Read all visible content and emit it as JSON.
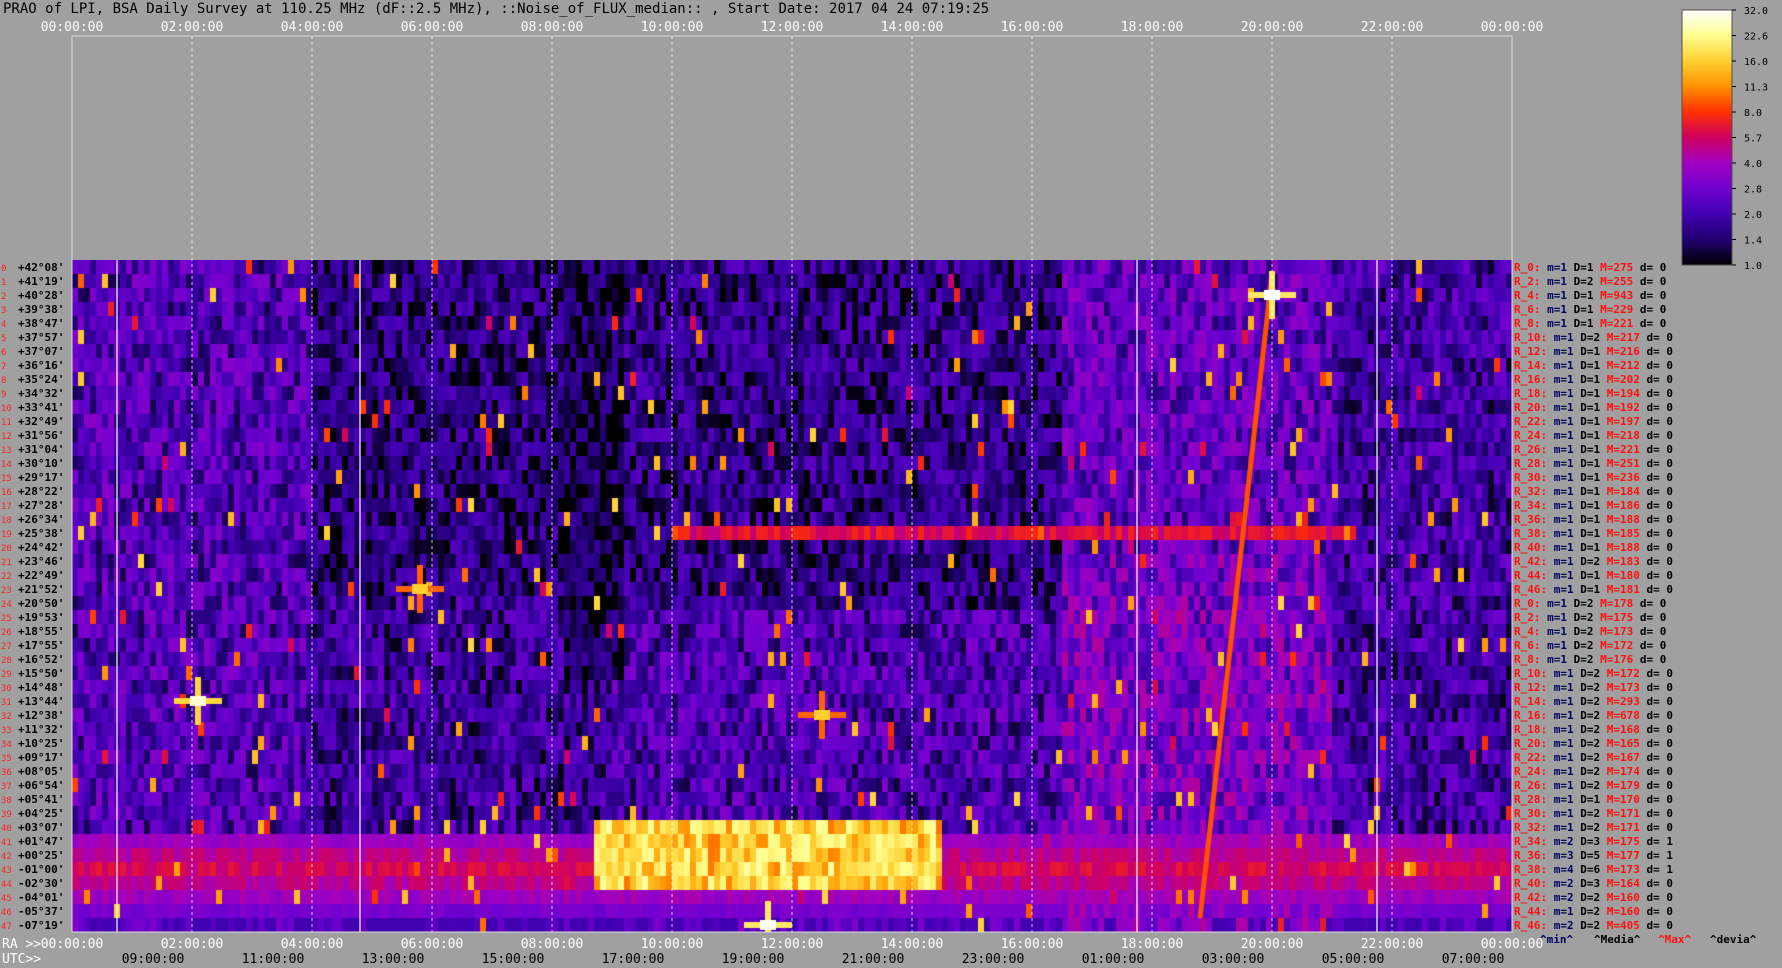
{
  "window": {
    "title": "PRAO of LPI, BSA Daily Survey at 110.25 MHz (dF::2.5 MHz), ::Noise_of_FLUX_median:: , Start Date: 2017 04 24 07:19:25"
  },
  "chart_data": {
    "type": "heatmap",
    "title": "PRAO of LPI, BSA Daily Survey at 110.25 MHz (dF::2.5 MHz), ::Noise_of_FLUX_median:: , Start Date: 2017 04 24 07:19:25",
    "x_top_ticks": [
      "00:00:00",
      "02:00:00",
      "04:00:00",
      "06:00:00",
      "08:00:00",
      "10:00:00",
      "12:00:00",
      "14:00:00",
      "16:00:00",
      "18:00:00",
      "20:00:00",
      "22:00:00",
      "00:00:00"
    ],
    "x_bottom_ra_label": "RA >>",
    "x_bottom_ra_ticks": [
      "00:00:00",
      "02:00:00",
      "04:00:00",
      "06:00:00",
      "08:00:00",
      "10:00:00",
      "12:00:00",
      "14:00:00",
      "16:00:00",
      "18:00:00",
      "20:00:00",
      "22:00:00",
      "00:00:00"
    ],
    "x_bottom_utc_label": "UTC>>",
    "x_bottom_utc_ticks": [
      "09:00:00",
      "11:00:00",
      "13:00:00",
      "15:00:00",
      "17:00:00",
      "19:00:00",
      "21:00:00",
      "23:00:00",
      "01:00:00",
      "03:00:00",
      "05:00:00",
      "07:00:00"
    ],
    "y_row_numbers": [
      "0",
      "1",
      "2",
      "3",
      "4",
      "5",
      "6",
      "7",
      "8",
      "9",
      "10",
      "11",
      "12",
      "13",
      "14",
      "15",
      "16",
      "17",
      "18",
      "19",
      "20",
      "21",
      "22",
      "23",
      "24",
      "25",
      "26",
      "27",
      "28",
      "29",
      "30",
      "31",
      "32",
      "33",
      "34",
      "35",
      "36",
      "37",
      "38",
      "39",
      "40",
      "41",
      "42",
      "43",
      "44",
      "45",
      "46",
      "47",
      "0",
      "1",
      "2",
      "3",
      "4",
      "5",
      "6",
      "7",
      "8",
      "9",
      "10",
      "11",
      "12",
      "13",
      "14",
      "15",
      "16",
      "17",
      "18",
      "19",
      "20",
      "21",
      "22",
      "23",
      "24",
      "25",
      "26",
      "27",
      "28",
      "29",
      "30",
      "31",
      "32",
      "33",
      "34",
      "35",
      "36",
      "37",
      "38",
      "39",
      "40",
      "41",
      "42",
      "43",
      "44",
      "45",
      "46",
      "47"
    ],
    "y_declination_labels": [
      "+42°08'",
      "+41°19'",
      "+40°28'",
      "+39°38'",
      "+38°47'",
      "+37°57'",
      "+37°07'",
      "+36°16'",
      "+35°24'",
      "+34°32'",
      "+33°41'",
      "+32°49'",
      "+31°56'",
      "+31°04'",
      "+30°10'",
      "+29°17'",
      "+28°22'",
      "+27°28'",
      "+26°34'",
      "+25°38'",
      "+24°42'",
      "+23°46'",
      "+22°49'",
      "+21°52'",
      "+20°50'",
      "+19°53'",
      "+18°55'",
      "+17°55'",
      "+16°52'",
      "+15°50'",
      "+14°48'",
      "+13°44'",
      "+12°38'",
      "+11°32'",
      "+10°25'",
      "+09°17'",
      "+08°05'",
      "+06°54'",
      "+05°41'",
      "+04°25'",
      "+03°07'",
      "+01°47'",
      "+00°25'",
      "-01°00'",
      "-02°30'",
      "-04°01'",
      "-05°37'",
      "-07°19'"
    ],
    "colorbar": {
      "ticks": [
        "32.0",
        "22.6",
        "16.0",
        "11.3",
        "8.0",
        "5.7",
        "4.0",
        "2.8",
        "2.0",
        "1.4",
        "1.0"
      ],
      "colors": [
        "#ffffff",
        "#ffff90",
        "#ffd030",
        "#ff9000",
        "#ff3000",
        "#d00060",
        "#a000c0",
        "#7000d0",
        "#4000b0",
        "#200070",
        "#000000"
      ]
    },
    "right_panel": {
      "headers": [
        "^min^",
        "^Media^",
        "^Max^",
        "^devia^"
      ],
      "rows": [
        [
          "R_0:",
          "m=1",
          "D=1",
          "M=275",
          "d= 0"
        ],
        [
          "R_2:",
          "m=1",
          "D=2",
          "M=255",
          "d= 0"
        ],
        [
          "R_4:",
          "m=1",
          "D=1",
          "M=943",
          "d= 0"
        ],
        [
          "R_6:",
          "m=1",
          "D=1",
          "M=229",
          "d= 0"
        ],
        [
          "R_8:",
          "m=1",
          "D=1",
          "M=221",
          "d= 0"
        ],
        [
          "R_10:",
          "m=1",
          "D=2",
          "M=217",
          "d= 0"
        ],
        [
          "R_12:",
          "m=1",
          "D=1",
          "M=216",
          "d= 0"
        ],
        [
          "R_14:",
          "m=1",
          "D=1",
          "M=212",
          "d= 0"
        ],
        [
          "R_16:",
          "m=1",
          "D=1",
          "M=202",
          "d= 0"
        ],
        [
          "R_18:",
          "m=1",
          "D=1",
          "M=194",
          "d= 0"
        ],
        [
          "R_20:",
          "m=1",
          "D=1",
          "M=192",
          "d= 0"
        ],
        [
          "R_22:",
          "m=1",
          "D=1",
          "M=197",
          "d= 0"
        ],
        [
          "R_24:",
          "m=1",
          "D=1",
          "M=218",
          "d= 0"
        ],
        [
          "R_26:",
          "m=1",
          "D=1",
          "M=221",
          "d= 0"
        ],
        [
          "R_28:",
          "m=1",
          "D=1",
          "M=251",
          "d= 0"
        ],
        [
          "R_30:",
          "m=1",
          "D=1",
          "M=236",
          "d= 0"
        ],
        [
          "R_32:",
          "m=1",
          "D=1",
          "M=184",
          "d= 0"
        ],
        [
          "R_34:",
          "m=1",
          "D=1",
          "M=186",
          "d= 0"
        ],
        [
          "R_36:",
          "m=1",
          "D=1",
          "M=188",
          "d= 0"
        ],
        [
          "R_38:",
          "m=1",
          "D=1",
          "M=185",
          "d= 0"
        ],
        [
          "R_40:",
          "m=1",
          "D=1",
          "M=188",
          "d= 0"
        ],
        [
          "R_42:",
          "m=1",
          "D=2",
          "M=183",
          "d= 0"
        ],
        [
          "R_44:",
          "m=1",
          "D=1",
          "M=180",
          "d= 0"
        ],
        [
          "R_46:",
          "m=1",
          "D=1",
          "M=181",
          "d= 0"
        ],
        [
          "R_0:",
          "m=1",
          "D=2",
          "M=178",
          "d= 0"
        ],
        [
          "R_2:",
          "m=1",
          "D=2",
          "M=175",
          "d= 0"
        ],
        [
          "R_4:",
          "m=1",
          "D=2",
          "M=173",
          "d= 0"
        ],
        [
          "R_6:",
          "m=1",
          "D=2",
          "M=172",
          "d= 0"
        ],
        [
          "R_8:",
          "m=1",
          "D=2",
          "M=176",
          "d= 0"
        ],
        [
          "R_10:",
          "m=1",
          "D=2",
          "M=172",
          "d= 0"
        ],
        [
          "R_12:",
          "m=1",
          "D=2",
          "M=173",
          "d= 0"
        ],
        [
          "R_14:",
          "m=1",
          "D=2",
          "M=293",
          "d= 0"
        ],
        [
          "R_16:",
          "m=1",
          "D=2",
          "M=678",
          "d= 0"
        ],
        [
          "R_18:",
          "m=1",
          "D=2",
          "M=168",
          "d= 0"
        ],
        [
          "R_20:",
          "m=1",
          "D=2",
          "M=165",
          "d= 0"
        ],
        [
          "R_22:",
          "m=1",
          "D=2",
          "M=167",
          "d= 0"
        ],
        [
          "R_24:",
          "m=1",
          "D=2",
          "M=174",
          "d= 0"
        ],
        [
          "R_26:",
          "m=1",
          "D=2",
          "M=179",
          "d= 0"
        ],
        [
          "R_28:",
          "m=1",
          "D=1",
          "M=170",
          "d= 0"
        ],
        [
          "R_30:",
          "m=1",
          "D=2",
          "M=171",
          "d= 0"
        ],
        [
          "R_32:",
          "m=1",
          "D=2",
          "M=171",
          "d= 0"
        ],
        [
          "R_34:",
          "m=2",
          "D=3",
          "M=175",
          "d= 1"
        ],
        [
          "R_36:",
          "m=3",
          "D=5",
          "M=177",
          "d= 1"
        ],
        [
          "R_38:",
          "m=4",
          "D=6",
          "M=173",
          "d= 1"
        ],
        [
          "R_40:",
          "m=2",
          "D=3",
          "M=164",
          "d= 0"
        ],
        [
          "R_42:",
          "m=2",
          "D=2",
          "M=160",
          "d= 0"
        ],
        [
          "R_44:",
          "m=1",
          "D=2",
          "M=160",
          "d= 0"
        ],
        [
          "R_46:",
          "m=2",
          "D=2",
          "M=405",
          "d= 0"
        ]
      ]
    },
    "features": [
      {
        "kind": "horizontal_band",
        "rows": [
          41,
          47
        ],
        "ra_hours": [
          0,
          24
        ],
        "level": 6.0
      },
      {
        "kind": "bright_patch",
        "rows": [
          40,
          44
        ],
        "ra_hours": [
          8.7,
          14.4
        ],
        "level": 22.6
      },
      {
        "kind": "hline",
        "row": 19,
        "ra_hours": [
          10.0,
          21.4
        ],
        "level": 7.0
      },
      {
        "kind": "diagonal_streak",
        "from": {
          "ra_hours": 20.0,
          "row": 1
        },
        "to": {
          "ra_hours": 18.8,
          "row": 47
        },
        "level": 9.0
      },
      {
        "kind": "point_source",
        "ra_hours": 20.0,
        "row": 2,
        "level": 32.0
      },
      {
        "kind": "point_source",
        "ra_hours": 2.1,
        "row": 31,
        "level": 28.0
      },
      {
        "kind": "point_source",
        "ra_hours": 11.6,
        "row": 47,
        "level": 32.0
      },
      {
        "kind": "point_source",
        "ra_hours": 12.5,
        "row": 32,
        "level": 16.0
      },
      {
        "kind": "point_source",
        "ra_hours": 5.8,
        "row": 23,
        "level": 16.0
      }
    ]
  }
}
